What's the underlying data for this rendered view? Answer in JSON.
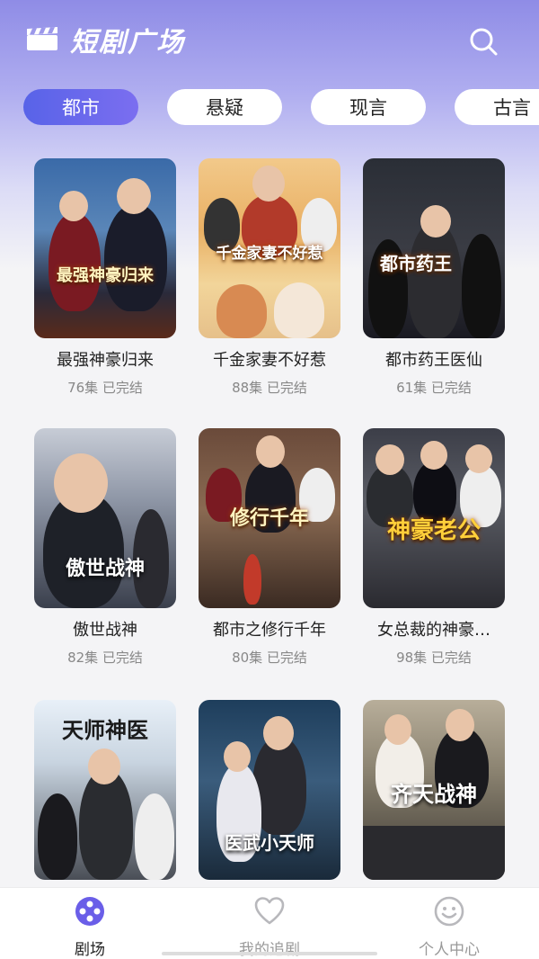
{
  "app": {
    "title": "短剧广场"
  },
  "icons": {
    "logo": "clapperboard-icon",
    "search": "search-icon"
  },
  "colors": {
    "accent": "#5f66ea",
    "accent2": "#7b6ef0",
    "text": "#222222",
    "muted": "#888888"
  },
  "tabs": [
    {
      "label": "都市",
      "active": true
    },
    {
      "label": "悬疑",
      "active": false
    },
    {
      "label": "现言",
      "active": false
    },
    {
      "label": "古言",
      "active": false
    }
  ],
  "dramas": [
    {
      "title": "最强神豪归来",
      "meta": "76集 已完结",
      "poster_text": "最强神豪归来"
    },
    {
      "title": "千金家妻不好惹",
      "meta": "88集 已完结",
      "poster_text": "千金家妻不好惹"
    },
    {
      "title": "都市药王医仙",
      "meta": "61集 已完结",
      "poster_text": "都市药王"
    },
    {
      "title": "傲世战神",
      "meta": "82集 已完结",
      "poster_text": "傲世战神"
    },
    {
      "title": "都市之修行千年",
      "meta": "80集 已完结",
      "poster_text": "修行千年"
    },
    {
      "title": "女总裁的神豪…",
      "meta": "98集 已完结",
      "poster_text": "神豪老公"
    },
    {
      "title": "",
      "meta": "",
      "poster_text": "天师神医"
    },
    {
      "title": "",
      "meta": "",
      "poster_text": "医武小天师"
    },
    {
      "title": "",
      "meta": "",
      "poster_text": "齐天战神"
    }
  ],
  "bottom_nav": [
    {
      "label": "剧场",
      "icon": "theater-icon",
      "active": true
    },
    {
      "label": "我的追剧",
      "icon": "heart-icon",
      "active": false
    },
    {
      "label": "个人中心",
      "icon": "smile-face-icon",
      "active": false
    }
  ]
}
